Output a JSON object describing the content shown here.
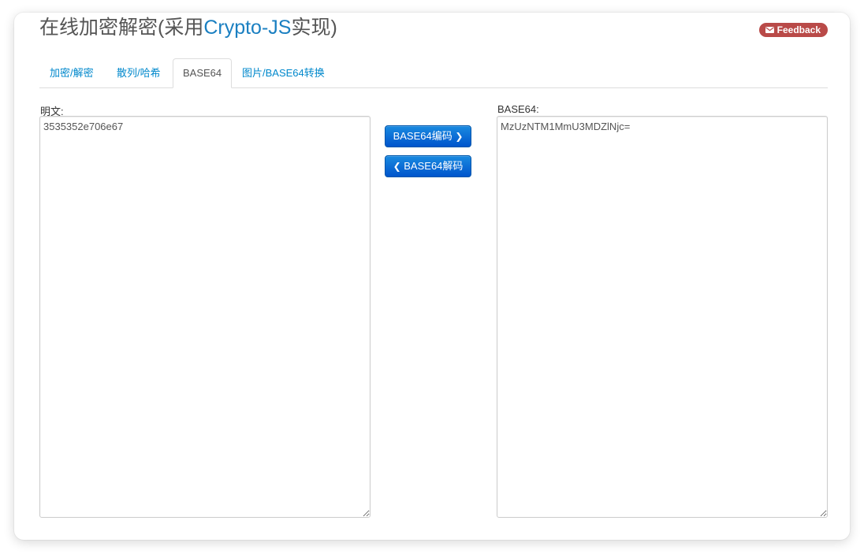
{
  "header": {
    "title_prefix": "在线加密解密(采用",
    "title_accent": "Crypto-JS",
    "title_suffix": "实现)",
    "feedback_label": "Feedback"
  },
  "tabs": [
    {
      "label": "加密/解密",
      "active": false
    },
    {
      "label": "散列/哈希",
      "active": false
    },
    {
      "label": "BASE64",
      "active": true
    },
    {
      "label": "图片/BASE64转换",
      "active": false
    }
  ],
  "plaintext": {
    "label": "明文:",
    "value": "3535352e706e67"
  },
  "base64": {
    "label": "BASE64:",
    "value": "MzUzNTM1MmU3MDZlNjc="
  },
  "buttons": {
    "encode_label": "BASE64编码",
    "encode_icon": "chevron-right-icon",
    "decode_label": "BASE64解码",
    "decode_icon": "chevron-left-icon"
  },
  "colors": {
    "accent": "#1a7fc1",
    "link": "#0088cc",
    "button": "#0066cc",
    "feedback": "#b94a48"
  }
}
